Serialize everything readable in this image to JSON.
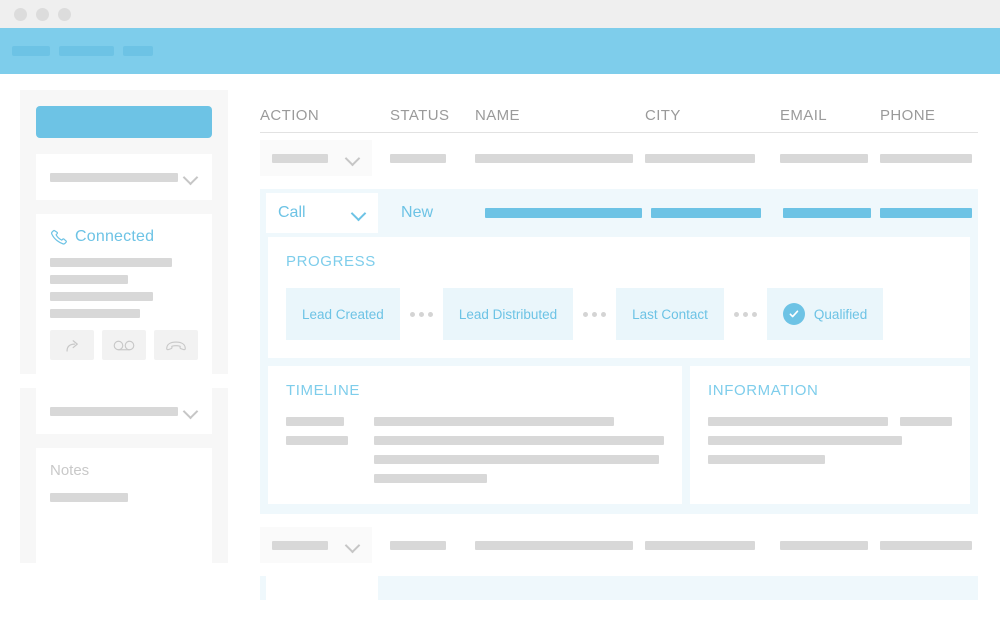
{
  "window": {
    "dots": [
      "close-dot",
      "minimize-dot",
      "maximize-dot"
    ]
  },
  "navbar": {
    "items": [
      "",
      "",
      ""
    ]
  },
  "sidebar": {
    "primary_button_label": "",
    "filter_select": {
      "value": "",
      "chevron": "chevron-down-icon"
    },
    "call_card": {
      "icon": "phone-handset-icon",
      "status": "Connected",
      "detail_lines": [
        "",
        "",
        "",
        ""
      ],
      "actions": [
        {
          "name": "transfer-call-button",
          "icon": "forward-arrow-icon"
        },
        {
          "name": "voicemail-button",
          "icon": "voicemail-icon"
        },
        {
          "name": "hangup-call-button",
          "icon": "phone-hangup-icon"
        }
      ]
    },
    "second_select": {
      "value": "",
      "chevron": "chevron-down-icon"
    },
    "notes_card": {
      "title": "Notes",
      "body_line": ""
    }
  },
  "table": {
    "columns": [
      "ACTION",
      "STATUS",
      "NAME",
      "CITY",
      "EMAIL",
      "PHONE"
    ],
    "rows": [
      {
        "action_value": "",
        "chevron": "chevron-down-icon",
        "status": "",
        "name": "",
        "city": "",
        "email": "",
        "phone": ""
      },
      {
        "action_value": "",
        "chevron": "chevron-down-icon",
        "status": "",
        "name": "",
        "city": "",
        "email": "",
        "phone": ""
      }
    ]
  },
  "expanded_row": {
    "action_select": {
      "value": "Call",
      "chevron": "chevron-down-icon"
    },
    "status": "New",
    "bars": [
      "",
      "",
      "",
      ""
    ],
    "progress": {
      "title": "PROGRESS",
      "steps": [
        {
          "label": "Lead Created",
          "completed": false
        },
        {
          "label": "Lead Distributed",
          "completed": false
        },
        {
          "label": "Last Contact",
          "completed": false
        },
        {
          "label": "Qualified",
          "completed": true,
          "icon": "check-circle-icon"
        }
      ],
      "separator": "three-dots"
    },
    "timeline": {
      "title": "TIMELINE",
      "entries": [
        {
          "label": "",
          "content": ""
        },
        {
          "label": "",
          "content": ""
        },
        {
          "label": "",
          "content": ""
        },
        {
          "label": "",
          "content": ""
        }
      ]
    },
    "information": {
      "title": "INFORMATION",
      "entries": [
        {
          "value": "",
          "extra": ""
        },
        {
          "value": ""
        },
        {
          "value": ""
        }
      ]
    }
  },
  "colors": {
    "accent": "#6dc3e5",
    "navbar": "#7ecdeb",
    "panel_bg": "#eff8fc",
    "step_bg": "#eaf6fb",
    "skeleton": "#d8d8d8",
    "header_text": "#9a9a9a"
  }
}
